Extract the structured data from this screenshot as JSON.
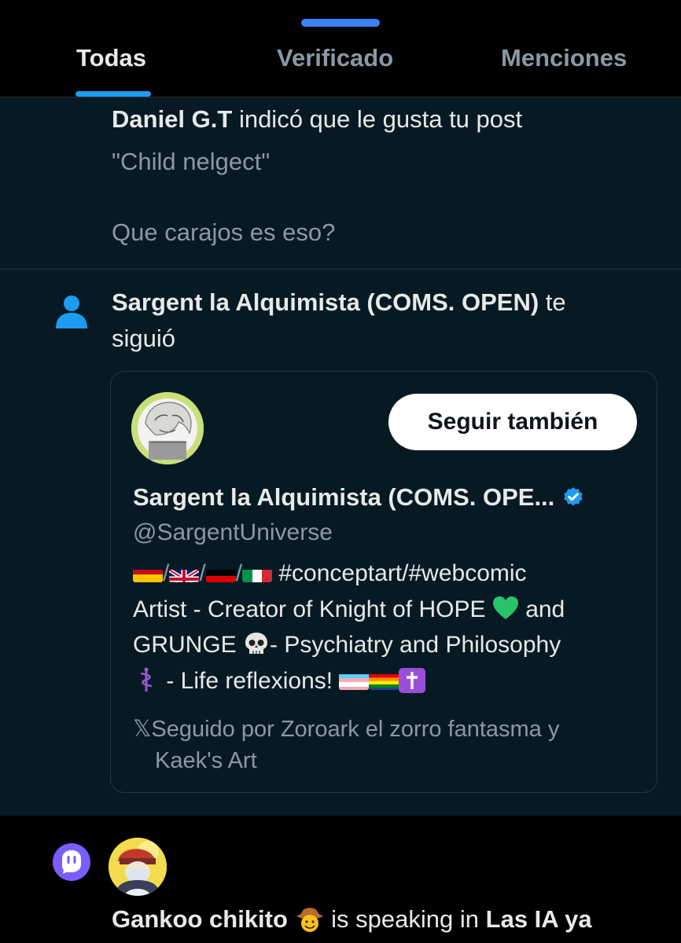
{
  "tabs": [
    {
      "label": "Todas",
      "active": true
    },
    {
      "label": "Verificado",
      "active": false
    },
    {
      "label": "Menciones",
      "active": false
    }
  ],
  "like_notification": {
    "user": "Daniel G.T",
    "action": "indicó que le gusta tu post",
    "post_line1": "\"Child nelgect\"",
    "post_line2": "Que carajos es eso?"
  },
  "follow_notification": {
    "user": "Sargent la Alquimista (COMS. OPEN)",
    "action_a": "te",
    "action_b": "siguió",
    "icon": "person-icon"
  },
  "profile_card": {
    "follow_button": "Seguir también",
    "display_name": "Sargent la Alquimista (COMS. OPE...",
    "handle": "@SargentUniverse",
    "bio_line1_text": "#conceptart/#webcomic",
    "bio_line2_text": "Artist - Creator of Knight of HOPE",
    "bio_line2_after": "and",
    "bio_line3_text": "GRUNGE",
    "bio_line3_after": "- Psychiatry and Philosophy",
    "bio_line4_text": "- Life reflexions!",
    "followed_by_line1": "Seguido por Zoroark el zorro fantasma y",
    "followed_by_line2": "Kaek's Art",
    "verified_color": "#1d9bf0"
  },
  "space_notification": {
    "speaker": "Gankoo chikito",
    "action": "is speaking in",
    "space": "Las IA ya",
    "icon": "spaces-mic-icon"
  },
  "colors": {
    "accent": "#1d9bf0",
    "panel_bg": "#071a24",
    "spaces_purple": "#7b5cff"
  }
}
